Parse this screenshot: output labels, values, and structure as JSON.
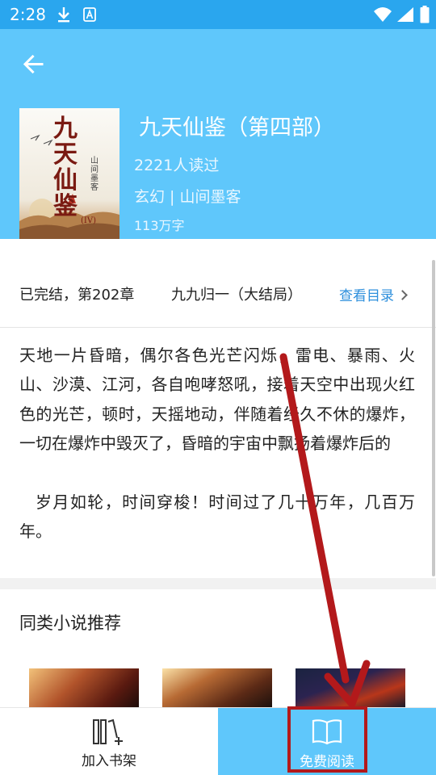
{
  "status_bar": {
    "time": "2:28",
    "icons": [
      "download-icon",
      "a-icon",
      "wifi-icon",
      "signal-icon",
      "battery-icon"
    ]
  },
  "header": {
    "back_icon": "arrow-left-icon",
    "background_color": "#5fc7fb"
  },
  "book": {
    "title": "九天仙鉴（第四部）",
    "read_count": "2221人读过",
    "genre_author": "玄幻 | 山间墨客",
    "word_count": "113万字",
    "cover": {
      "title": "九天仙鉴",
      "author": "山间墨客",
      "volume": "(IV)"
    }
  },
  "chapter": {
    "status": "已完结，第202章",
    "name": "九九归一（大结局）",
    "toc_label": "查看目录"
  },
  "synopsis": {
    "paragraph_1": "天地一片昏暗，偶尔各色光芒闪烁，雷电、暴雨、火山、沙漠、江河，各自咆哮怒吼，接着天空中出现火红色的光芒，顿时，天摇地动，伴随着经久不休的爆炸，一切在爆炸中毁灭了，昏暗的宇宙中飘扬着爆炸后的",
    "paragraph_2": "岁月如轮，时间穿梭！时间过了几十万年，几百万年。"
  },
  "recommend": {
    "title": "同类小说推荐"
  },
  "bottom_bar": {
    "add_shelf_label": "加入书架",
    "free_read_label": "免费阅读"
  },
  "colors": {
    "status_bar": "#2aa6ee",
    "accent": "#5fc7fb",
    "link": "#2d8fdc",
    "annotation": "#b3191b"
  }
}
